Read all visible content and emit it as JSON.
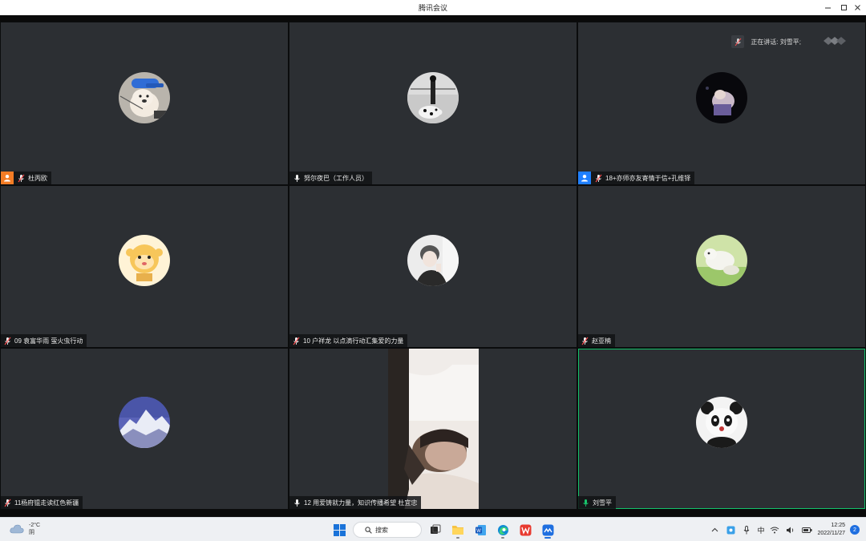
{
  "window": {
    "title": "腾讯会议"
  },
  "speaking": {
    "prefix": "正在讲话: ",
    "name": "刘雪平;"
  },
  "accent": {
    "active_border": "#13c26a",
    "host": "#f37c25",
    "cohost": "#1f7fff",
    "tile_bg": "#2c2f33"
  },
  "tiles": [
    {
      "name": "杜丙欧",
      "role": "host",
      "mic": "muted",
      "avatar": "dog-cap-avatar"
    },
    {
      "name": "努尔夜巴（工作人员）",
      "role": "none",
      "mic": "on",
      "avatar": "dog-bw-avatar"
    },
    {
      "name": "18+亦师亦友寄情于信+孔维铎",
      "role": "cohost",
      "mic": "muted",
      "avatar": "night-avatar"
    },
    {
      "name": "09 袁富华雨 萤火虫行动",
      "role": "none",
      "mic": "muted",
      "avatar": "cartoon-avatar"
    },
    {
      "name": "10  户祥龙  以点滴行动汇集爱的力量",
      "role": "none",
      "mic": "muted",
      "avatar": "boy-avatar"
    },
    {
      "name": "赵亚楠",
      "role": "none",
      "mic": "muted",
      "avatar": "animal-avatar"
    },
    {
      "name": "11杨府锟走读红色新疆",
      "role": "none",
      "mic": "muted",
      "avatar": "mountain-avatar"
    },
    {
      "name": "12 用爱铸就力量，知识传播希望 杜宜忠",
      "role": "none",
      "mic": "on",
      "avatar": "video"
    },
    {
      "name": "刘雪平",
      "role": "none",
      "mic": "active",
      "avatar": "panda-avatar"
    }
  ],
  "taskbar": {
    "weather_temp": "-2°C",
    "weather_desc": "阴",
    "search_label": "搜索",
    "ime": "中",
    "time": "12:25",
    "date": "2022/11/27",
    "notifications": "2"
  }
}
